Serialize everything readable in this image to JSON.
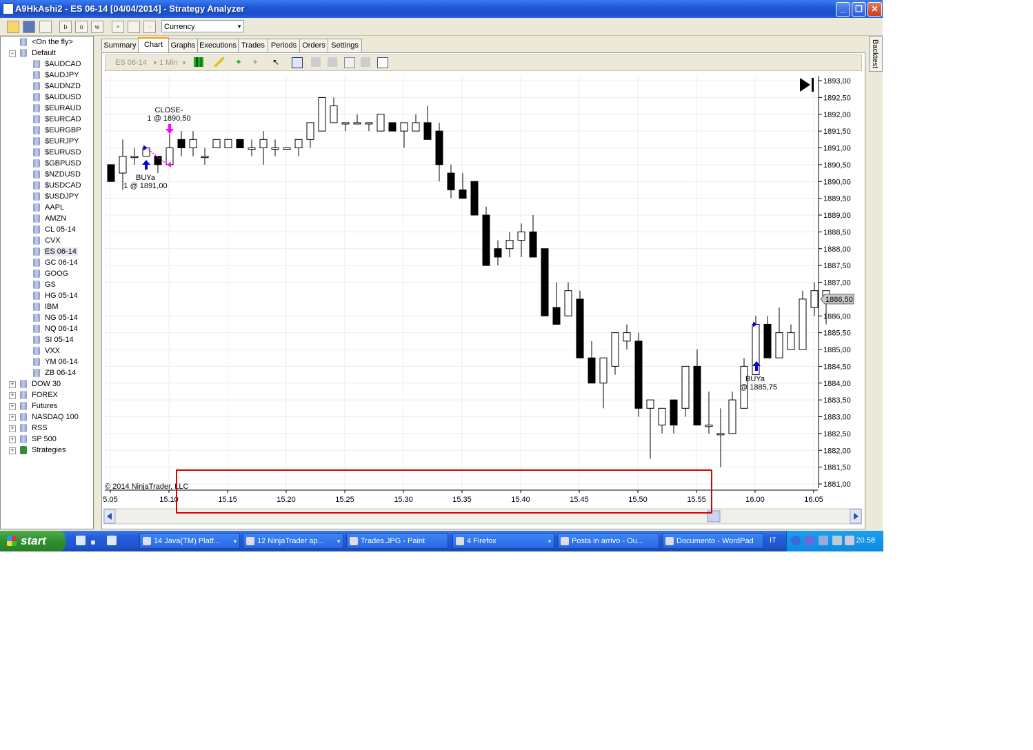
{
  "window": {
    "title": "A9HkAshi2 - ES 06-14 [04/04/2014] - Strategy Analyzer",
    "minimize": "_",
    "maximize": "❐",
    "close": "✕"
  },
  "toolbar": {
    "currency_label": "Currency",
    "btn_b": "b",
    "btn_o": "o",
    "btn_w": "w"
  },
  "tree": {
    "nodes": [
      {
        "label": "<On the fly>",
        "indent": 2,
        "exp": ""
      },
      {
        "label": "Default",
        "indent": 1,
        "exp": "−"
      },
      {
        "label": "$AUDCAD",
        "indent": 3
      },
      {
        "label": "$AUDJPY",
        "indent": 3
      },
      {
        "label": "$AUDNZD",
        "indent": 3
      },
      {
        "label": "$AUDUSD",
        "indent": 3
      },
      {
        "label": "$EURAUD",
        "indent": 3
      },
      {
        "label": "$EURCAD",
        "indent": 3
      },
      {
        "label": "$EURGBP",
        "indent": 3
      },
      {
        "label": "$EURJPY",
        "indent": 3
      },
      {
        "label": "$EURUSD",
        "indent": 3
      },
      {
        "label": "$GBPUSD",
        "indent": 3
      },
      {
        "label": "$NZDUSD",
        "indent": 3
      },
      {
        "label": "$USDCAD",
        "indent": 3
      },
      {
        "label": "$USDJPY",
        "indent": 3
      },
      {
        "label": "AAPL",
        "indent": 3
      },
      {
        "label": "AMZN",
        "indent": 3
      },
      {
        "label": "CL 05-14",
        "indent": 3
      },
      {
        "label": "CVX",
        "indent": 3
      },
      {
        "label": "ES 06-14",
        "indent": 3,
        "selected": true
      },
      {
        "label": "GC 06-14",
        "indent": 3
      },
      {
        "label": "GOOG",
        "indent": 3
      },
      {
        "label": "GS",
        "indent": 3
      },
      {
        "label": "HG 05-14",
        "indent": 3
      },
      {
        "label": "IBM",
        "indent": 3
      },
      {
        "label": "NG 05-14",
        "indent": 3
      },
      {
        "label": "NQ 06-14",
        "indent": 3
      },
      {
        "label": "SI 05-14",
        "indent": 3
      },
      {
        "label": "VXX",
        "indent": 3
      },
      {
        "label": "YM 06-14",
        "indent": 3
      },
      {
        "label": "ZB 06-14",
        "indent": 3
      },
      {
        "label": "DOW 30",
        "indent": 1,
        "exp": "+"
      },
      {
        "label": "FOREX",
        "indent": 1,
        "exp": "+"
      },
      {
        "label": "Futures",
        "indent": 1,
        "exp": "+"
      },
      {
        "label": "NASDAQ 100",
        "indent": 1,
        "exp": "+"
      },
      {
        "label": "RSS",
        "indent": 1,
        "exp": "+"
      },
      {
        "label": "SP 500",
        "indent": 1,
        "exp": "+"
      },
      {
        "label": "Strategies",
        "indent": 1,
        "exp": "+",
        "strategy": true
      }
    ]
  },
  "tabs": [
    "Summary",
    "Chart",
    "Graphs",
    "Executions",
    "Trades",
    "Periods",
    "Orders",
    "Settings"
  ],
  "active_tab": "Chart",
  "backtest_label": "Backtest",
  "chart_toolbar": {
    "instrument": "ES 06-14",
    "interval": "1 Min"
  },
  "chart": {
    "copyright": "© 2014 NinjaTrader, LLC",
    "current_price_label": "1886,50",
    "y_ticks": [
      "1893,00",
      "1892,50",
      "1892,00",
      "1891,50",
      "1891,00",
      "1890,50",
      "1890,00",
      "1889,50",
      "1889,00",
      "1888,50",
      "1888,00",
      "1887,50",
      "1887,00",
      "1886,00",
      "1885,50",
      "1885,00",
      "1884,50",
      "1884,00",
      "1883,50",
      "1883,00",
      "1882,50",
      "1882,00",
      "1881,50",
      "1881,00"
    ],
    "x_ticks": [
      "5.05",
      "15.10",
      "15.15",
      "15.20",
      "15.25",
      "15.30",
      "15.35",
      "15.40",
      "15.45",
      "15.50",
      "15.55",
      "16.00",
      "16.05"
    ],
    "annotations": {
      "close_title": "CLOSE-",
      "close_detail": "1 @ 1890,50",
      "buy1_title": "BUYa",
      "buy1_detail": "1 @ 1891,00",
      "buy2_title": "BUYa",
      "buy2_detail": "@ 1885,75"
    },
    "colors": {
      "buy_arrow": "#0000e0",
      "close_arrow": "#ff00ff",
      "highlight_box": "#dd0000"
    }
  },
  "chart_data": {
    "type": "candlestick",
    "y_range": [
      1880.75,
      1893.25
    ],
    "bars": [
      {
        "o": 1890.5,
        "h": 1890.5,
        "l": 1890.0,
        "c": 1890.0
      },
      {
        "o": 1890.25,
        "h": 1891.25,
        "l": 1889.75,
        "c": 1890.75
      },
      {
        "o": 1890.75,
        "h": 1891.0,
        "l": 1890.5,
        "c": 1890.75
      },
      {
        "o": 1890.75,
        "h": 1891.0,
        "l": 1890.75,
        "c": 1891.0
      },
      {
        "o": 1890.75,
        "h": 1890.75,
        "l": 1890.25,
        "c": 1890.5
      },
      {
        "o": 1890.5,
        "h": 1891.5,
        "l": 1890.5,
        "c": 1891.0
      },
      {
        "o": 1891.25,
        "h": 1891.5,
        "l": 1890.75,
        "c": 1891.0
      },
      {
        "o": 1891.0,
        "h": 1891.5,
        "l": 1890.75,
        "c": 1891.25
      },
      {
        "o": 1890.75,
        "h": 1891.0,
        "l": 1890.5,
        "c": 1890.75
      },
      {
        "o": 1891.0,
        "h": 1891.25,
        "l": 1891.0,
        "c": 1891.25
      },
      {
        "o": 1891.0,
        "h": 1891.25,
        "l": 1891.0,
        "c": 1891.25
      },
      {
        "o": 1891.25,
        "h": 1891.25,
        "l": 1891.0,
        "c": 1891.0
      },
      {
        "o": 1891.0,
        "h": 1891.25,
        "l": 1890.75,
        "c": 1891.0
      },
      {
        "o": 1891.0,
        "h": 1891.5,
        "l": 1890.5,
        "c": 1891.25
      },
      {
        "o": 1891.0,
        "h": 1891.25,
        "l": 1890.75,
        "c": 1891.0
      },
      {
        "o": 1891.0,
        "h": 1891.0,
        "l": 1891.0,
        "c": 1891.0
      },
      {
        "o": 1891.0,
        "h": 1891.25,
        "l": 1890.75,
        "c": 1891.25
      },
      {
        "o": 1891.25,
        "h": 1891.75,
        "l": 1891.0,
        "c": 1891.75
      },
      {
        "o": 1891.5,
        "h": 1892.5,
        "l": 1891.5,
        "c": 1892.5
      },
      {
        "o": 1891.75,
        "h": 1892.5,
        "l": 1891.75,
        "c": 1892.25
      },
      {
        "o": 1891.75,
        "h": 1891.75,
        "l": 1891.5,
        "c": 1891.75
      },
      {
        "o": 1891.75,
        "h": 1892.0,
        "l": 1891.75,
        "c": 1891.75
      },
      {
        "o": 1891.75,
        "h": 1891.75,
        "l": 1891.5,
        "c": 1891.75
      },
      {
        "o": 1891.5,
        "h": 1892.0,
        "l": 1891.5,
        "c": 1892.0
      },
      {
        "o": 1891.75,
        "h": 1891.75,
        "l": 1891.5,
        "c": 1891.5
      },
      {
        "o": 1891.5,
        "h": 1891.75,
        "l": 1891.0,
        "c": 1891.75
      },
      {
        "o": 1891.5,
        "h": 1892.0,
        "l": 1891.5,
        "c": 1891.75
      },
      {
        "o": 1891.75,
        "h": 1892.25,
        "l": 1891.25,
        "c": 1891.25
      },
      {
        "o": 1891.5,
        "h": 1891.75,
        "l": 1890.0,
        "c": 1890.5
      },
      {
        "o": 1890.25,
        "h": 1890.5,
        "l": 1889.5,
        "c": 1889.75
      },
      {
        "o": 1889.75,
        "h": 1890.25,
        "l": 1889.5,
        "c": 1889.5
      },
      {
        "o": 1890.0,
        "h": 1890.0,
        "l": 1889.25,
        "c": 1889.0
      },
      {
        "o": 1889.0,
        "h": 1889.25,
        "l": 1887.5,
        "c": 1887.5
      },
      {
        "o": 1888.0,
        "h": 1888.25,
        "l": 1887.5,
        "c": 1887.75
      },
      {
        "o": 1888.0,
        "h": 1888.5,
        "l": 1887.75,
        "c": 1888.25
      },
      {
        "o": 1888.25,
        "h": 1888.75,
        "l": 1887.75,
        "c": 1888.5
      },
      {
        "o": 1888.5,
        "h": 1889.0,
        "l": 1887.75,
        "c": 1887.75
      },
      {
        "o": 1888.0,
        "h": 1888.0,
        "l": 1886.0,
        "c": 1886.0
      },
      {
        "o": 1886.25,
        "h": 1887.0,
        "l": 1886.0,
        "c": 1885.75
      },
      {
        "o": 1886.0,
        "h": 1887.0,
        "l": 1886.0,
        "c": 1886.75
      },
      {
        "o": 1886.5,
        "h": 1886.75,
        "l": 1884.75,
        "c": 1884.75
      },
      {
        "o": 1884.75,
        "h": 1885.25,
        "l": 1884.0,
        "c": 1884.0
      },
      {
        "o": 1884.0,
        "h": 1884.75,
        "l": 1883.25,
        "c": 1884.75
      },
      {
        "o": 1884.5,
        "h": 1885.5,
        "l": 1884.25,
        "c": 1885.5
      },
      {
        "o": 1885.25,
        "h": 1885.75,
        "l": 1885.0,
        "c": 1885.5
      },
      {
        "o": 1885.25,
        "h": 1885.5,
        "l": 1883.0,
        "c": 1883.25
      },
      {
        "o": 1883.25,
        "h": 1883.5,
        "l": 1881.75,
        "c": 1883.5
      },
      {
        "o": 1882.75,
        "h": 1883.25,
        "l": 1882.5,
        "c": 1883.25
      },
      {
        "o": 1883.5,
        "h": 1883.5,
        "l": 1882.5,
        "c": 1882.75
      },
      {
        "o": 1883.25,
        "h": 1884.5,
        "l": 1883.0,
        "c": 1884.5
      },
      {
        "o": 1884.5,
        "h": 1885.0,
        "l": 1882.75,
        "c": 1882.75
      },
      {
        "o": 1882.75,
        "h": 1883.75,
        "l": 1882.5,
        "c": 1882.75
      },
      {
        "o": 1882.5,
        "h": 1883.25,
        "l": 1881.5,
        "c": 1882.5
      },
      {
        "o": 1882.5,
        "h": 1883.75,
        "l": 1882.5,
        "c": 1883.5
      },
      {
        "o": 1883.25,
        "h": 1884.75,
        "l": 1883.25,
        "c": 1884.5
      },
      {
        "o": 1884.25,
        "h": 1886.0,
        "l": 1884.25,
        "c": 1885.75
      },
      {
        "o": 1885.75,
        "h": 1886.0,
        "l": 1885.0,
        "c": 1884.75
      },
      {
        "o": 1884.75,
        "h": 1886.25,
        "l": 1884.75,
        "c": 1885.5
      },
      {
        "o": 1885.0,
        "h": 1885.75,
        "l": 1885.0,
        "c": 1885.5
      },
      {
        "o": 1885.0,
        "h": 1886.75,
        "l": 1885.0,
        "c": 1886.5
      },
      {
        "o": 1886.25,
        "h": 1887.0,
        "l": 1886.0,
        "c": 1886.75
      },
      {
        "o": 1886.5,
        "h": 1886.75,
        "l": 1885.75,
        "c": 1886.75
      }
    ]
  },
  "taskbar": {
    "start_label": "start",
    "lang": "IT",
    "clock": "20.58",
    "tasks": [
      {
        "label": "14 Java(TM) Platf...",
        "dd": "▾"
      },
      {
        "label": "12 NinjaTrader ap...",
        "dd": "▾"
      },
      {
        "label": "Trades.JPG - Paint",
        "dd": ""
      },
      {
        "label": "4 Firefox",
        "dd": "▾"
      },
      {
        "label": "Posta in arrivo - Ou...",
        "dd": ""
      },
      {
        "label": "Documento - WordPad",
        "dd": ""
      }
    ]
  }
}
